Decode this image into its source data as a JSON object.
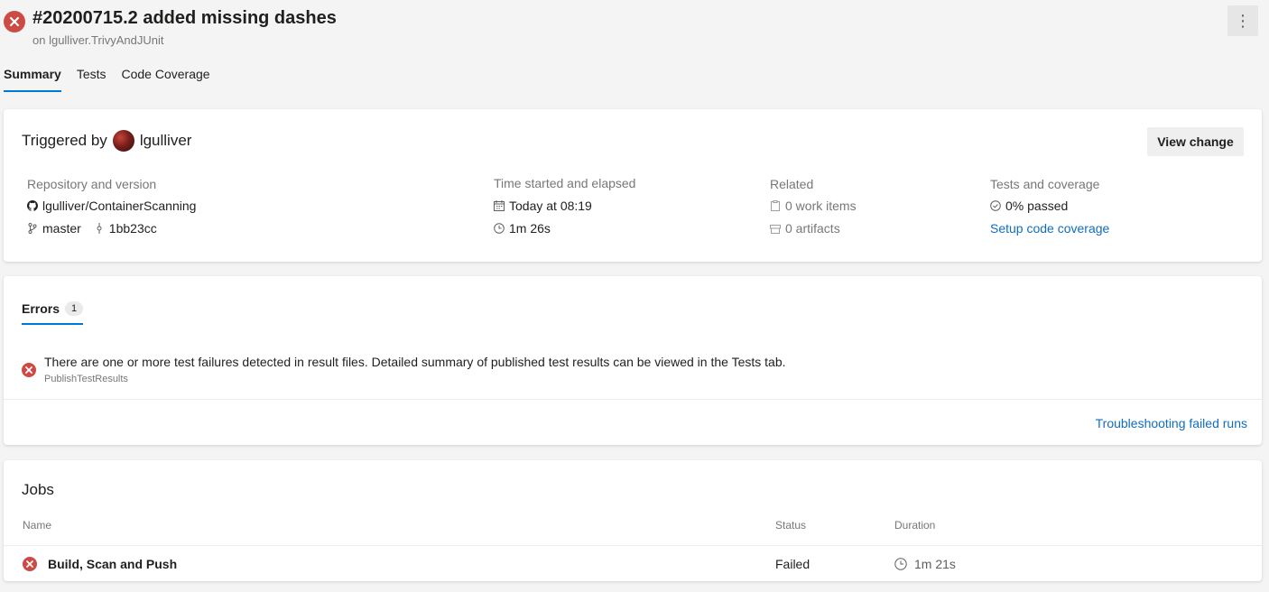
{
  "header": {
    "title": "#20200715.2 added missing dashes",
    "subtitle": "on lgulliver.TrivyAndJUnit",
    "status": "failed"
  },
  "tabs": [
    {
      "label": "Summary",
      "active": true
    },
    {
      "label": "Tests",
      "active": false
    },
    {
      "label": "Code Coverage",
      "active": false
    }
  ],
  "summary": {
    "triggered_prefix": "Triggered by",
    "triggered_user": "lgulliver",
    "view_change_label": "View change",
    "repo_heading": "Repository and version",
    "repo_name": "lgulliver/ContainerScanning",
    "branch": "master",
    "commit": "1bb23cc",
    "time_heading": "Time started and elapsed",
    "started": "Today at 08:19",
    "elapsed": "1m 26s",
    "related_heading": "Related",
    "work_items": "0 work items",
    "artifacts": "0 artifacts",
    "tests_heading": "Tests and coverage",
    "tests_passed": "0% passed",
    "setup_coverage_link": "Setup code coverage"
  },
  "errors": {
    "tab_label": "Errors",
    "count": "1",
    "items": [
      {
        "message": "There are one or more test failures detected in result files. Detailed summary of published test results can be viewed in the Tests tab.",
        "source": "PublishTestResults"
      }
    ],
    "troubleshoot_link": "Troubleshooting failed runs"
  },
  "jobs": {
    "title": "Jobs",
    "columns": {
      "name": "Name",
      "status": "Status",
      "duration": "Duration"
    },
    "rows": [
      {
        "name": "Build, Scan and Push",
        "status": "Failed",
        "duration": "1m 21s"
      }
    ]
  },
  "colors": {
    "error": "#cd4a45",
    "accent": "#0078d4",
    "link": "#106ebe"
  }
}
